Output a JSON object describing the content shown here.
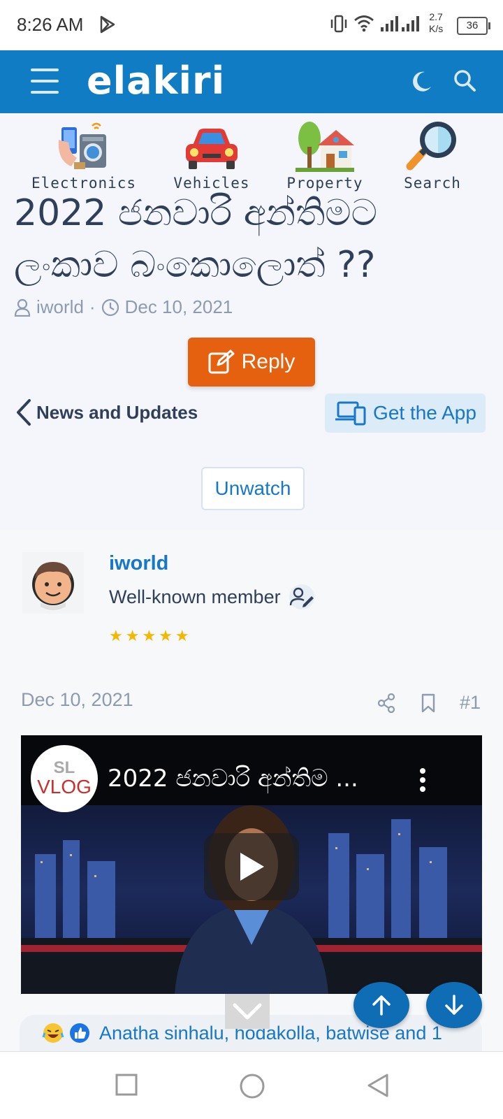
{
  "status_bar": {
    "time": "8:26 AM",
    "net_speed_value": "2.7",
    "net_speed_unit": "K/s",
    "battery": "36"
  },
  "header": {
    "logo": "elakiri",
    "icons": [
      "menu-icon",
      "moon-icon",
      "search-icon"
    ]
  },
  "categories": [
    {
      "label": "Electronics",
      "icon": "electronics-icon"
    },
    {
      "label": "Vehicles",
      "icon": "car-icon"
    },
    {
      "label": "Property",
      "icon": "house-icon"
    },
    {
      "label": "Search",
      "icon": "magnifier-icon"
    }
  ],
  "thread": {
    "title": "2022 ජනවාරි අන්තිමට ලංකාව බංකොලොත් ??",
    "author": "iworld",
    "separator": "·",
    "date": "Dec 10, 2021"
  },
  "actions": {
    "reply": "Reply",
    "back_label": "News and Updates",
    "get_app": "Get the App",
    "unwatch": "Unwatch"
  },
  "post": {
    "username": "iworld",
    "user_title": "Well-known member",
    "rating_stars": 5,
    "stars_text": "★★★★★",
    "date": "Dec 10, 2021",
    "number": "#1",
    "video": {
      "title": "2022 ජනවාරි අන්තිම ...",
      "channel_text_1": "SL",
      "channel_text_2": "VLOG"
    },
    "reactions_text": "Anatha sinhalu, hodakolla, batwise and 1"
  },
  "colors": {
    "brand": "#0f7cc4",
    "reply": "#e5610f",
    "link": "#1777c8",
    "star": "#f5b700"
  }
}
